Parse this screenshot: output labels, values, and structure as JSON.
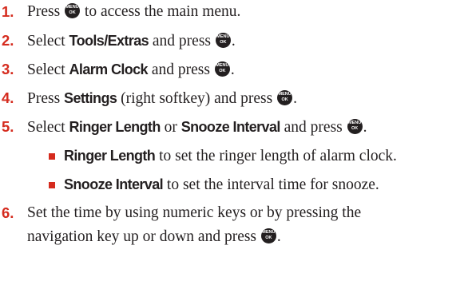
{
  "key_icon": {
    "top": "MENU",
    "bottom": "OK"
  },
  "colors": {
    "accent": "#d52b1e",
    "text": "#231f20",
    "icon": "#231f20"
  },
  "steps": [
    {
      "number": "1.",
      "t1": "Press ",
      "t2": " to access the main menu."
    },
    {
      "number": "2.",
      "t1": "Select ",
      "b1": "Tools/Extras",
      "t2": " and press ",
      "t3": "."
    },
    {
      "number": "3.",
      "t1": "Select ",
      "b1": "Alarm Clock",
      "t2": " and press ",
      "t3": "."
    },
    {
      "number": "4.",
      "t1": "Press ",
      "b1": "Settings",
      "t2": " (right softkey) and press ",
      "t3": "."
    },
    {
      "number": "5.",
      "t1": "Select ",
      "b1": "Ringer Length",
      "t2": " or ",
      "b2": "Snooze Interval",
      "t3": " and press ",
      "t4": ".",
      "bullets": [
        {
          "term": "Ringer Length",
          "desc": " to set the ringer length of alarm clock."
        },
        {
          "term": "Snooze Interval",
          "desc": " to set the interval time for snooze."
        }
      ]
    },
    {
      "number": "6.",
      "line1": "Set the time by using numeric keys or by pressing the",
      "line2": "navigation key up or down and press ",
      "t_end": "."
    }
  ]
}
